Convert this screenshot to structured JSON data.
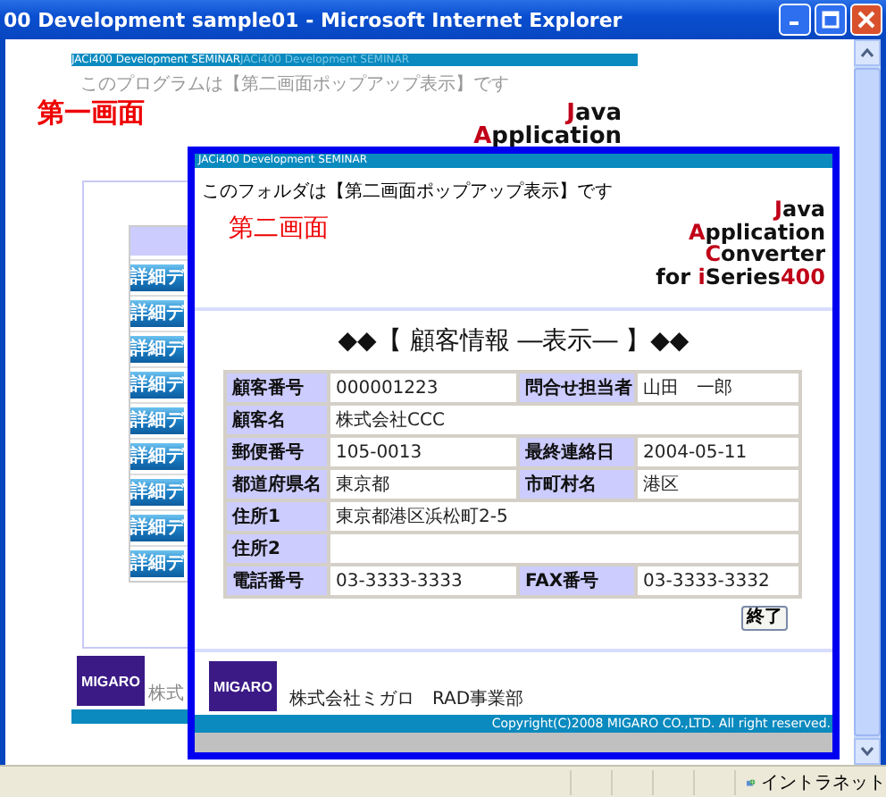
{
  "window": {
    "title": "00 Development sample01 - Microsoft Internet Explorer"
  },
  "first_screen": {
    "header_bar": [
      {
        "text": "JACi400 Development SEMINAR",
        "faded": false
      },
      {
        "text": "JACi400 Development SEMINAR",
        "faded": true
      }
    ],
    "notice": "このプログラムは【第二画面ポップアップ表示】です",
    "screen_title": "第一画面",
    "logo": [
      [
        {
          "text": "J",
          "accent": true
        },
        {
          "text": "ava",
          "accent": false
        }
      ],
      [
        {
          "text": "A",
          "accent": true
        },
        {
          "text": "pplication",
          "accent": false
        }
      ]
    ],
    "detail_buttons": [
      "詳細デ",
      "詳細デ",
      "詳細デ",
      "詳細デ",
      "詳細デ",
      "詳細デ",
      "詳細デ",
      "詳細デ",
      "詳細デ"
    ],
    "company_logo": "MIGARO",
    "footer_text": "株式"
  },
  "popup": {
    "header_bar": "JACi400 Development SEMINAR",
    "notice": "このフォルダは【第二画面ポップアップ表示】です",
    "screen_title": "第二画面",
    "logo": [
      [
        {
          "text": "J",
          "accent": true
        },
        {
          "text": "ava",
          "accent": false
        }
      ],
      [
        {
          "text": "A",
          "accent": true
        },
        {
          "text": "pplication",
          "accent": false
        }
      ],
      [
        {
          "text": "C",
          "accent": true
        },
        {
          "text": "onverter",
          "accent": false
        }
      ],
      [
        {
          "text": "for ",
          "accent": false
        },
        {
          "text": "i",
          "accent": true
        },
        {
          "text": "Series",
          "accent": false
        },
        {
          "text": "400",
          "accent": true
        }
      ]
    ],
    "heading": "◆◆【 顧客情報 ―表示― 】◆◆",
    "rows": [
      [
        {
          "label": "顧客番号",
          "value": "000001223"
        },
        {
          "label": "問合せ担当者",
          "value": "山田　一郎"
        }
      ],
      [
        {
          "label": "顧客名",
          "value": "株式会社CCC"
        }
      ],
      [
        {
          "label": "郵便番号",
          "value": "105-0013"
        },
        {
          "label": "最終連絡日",
          "value": "2004-05-11"
        }
      ],
      [
        {
          "label": "都道府県名",
          "value": "東京都"
        },
        {
          "label": "市町村名",
          "value": "港区"
        }
      ],
      [
        {
          "label": "住所1",
          "value": "東京都港区浜松町2-5"
        }
      ],
      [
        {
          "label": "住所2"
        }
      ],
      [
        {
          "label": "電話番号",
          "value": "03-3333-3333"
        },
        {
          "label": "FAX番号",
          "value": "03-3333-3332"
        }
      ]
    ],
    "close_button": "終了",
    "company_logo": "MIGARO",
    "company": "株式会社ミガロ　RAD事業部",
    "copyright": "Copyright(C)2008 MIGARO CO.,LTD. All right reserved."
  },
  "status_bar": {
    "zone": "イントラネット"
  }
}
